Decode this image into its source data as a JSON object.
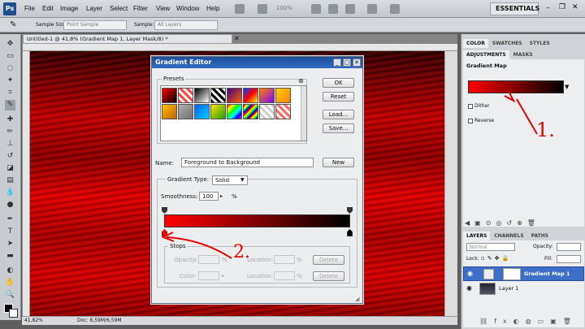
{
  "app": {
    "logo": "Ps"
  },
  "menu": [
    "File",
    "Edit",
    "Image",
    "Layer",
    "Select",
    "Filter",
    "View",
    "Window",
    "Help"
  ],
  "workspace": "ESSENTIALS",
  "zoom_box": "100%",
  "options": {
    "sample_size_label": "Sample Size:",
    "sample_size_value": "Point Sample",
    "sample_label": "Sample:",
    "sample_value": "All Layers"
  },
  "document": {
    "tab": "Untitled-1 @ 41,8% (Gradient Map 1, Layer Mask/8) *",
    "zoom": "41,82%",
    "doc_info": "Doc: 6,59M/6,59M"
  },
  "panels": {
    "top_tabs": [
      "COLOR",
      "SWATCHES",
      "STYLES"
    ],
    "adj_tabs": [
      "ADJUSTMENTS",
      "MASKS"
    ],
    "adj_title": "Gradient Map",
    "dither": "Dither",
    "reverse": "Reverse",
    "layer_tabs": [
      "LAYERS",
      "CHANNELS",
      "PATHS"
    ],
    "blend": "Normal",
    "opacity_label": "Opacity:",
    "lock_label": "Lock:",
    "fill_label": "Fill:",
    "layers": [
      "Gradient Map 1",
      "Layer 1"
    ]
  },
  "dialog": {
    "title": "Gradient Editor",
    "presets": "Presets",
    "ok": "OK",
    "reset": "Reset",
    "load": "Load...",
    "save": "Save...",
    "name_label": "Name:",
    "name_value": "Foreground to Background",
    "new": "New",
    "gradient_type_label": "Gradient Type:",
    "gradient_type_value": "Solid",
    "smoothness_label": "Smoothness:",
    "smoothness_value": "100",
    "smoothness_unit": "%",
    "stops": "Stops",
    "opacity_label": "Opacity:",
    "location_label": "Location:",
    "color_label": "Color:",
    "percent": "%",
    "delete": "Delete"
  },
  "annotations": {
    "one": "1.",
    "two": "2."
  },
  "colors": {
    "accent": "#e60000",
    "titlebar": "#2d6bc4"
  }
}
